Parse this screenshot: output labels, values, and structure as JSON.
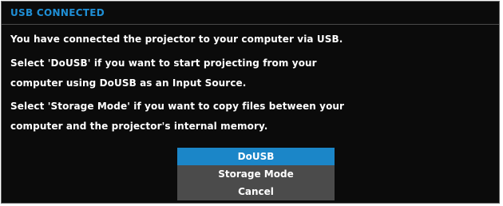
{
  "theme": {
    "title_color": "#1f8fd6",
    "selected_bg": "#1b86c8",
    "menu_bg": "#4b4b4b"
  },
  "dialog": {
    "title": "USB CONNECTED",
    "lines": [
      "You have connected the projector to your computer via USB.",
      "Select 'DoUSB' if you want to start projecting from your",
      "computer using DoUSB as an Input Source.",
      "Select 'Storage Mode' if you want to copy files between your",
      "computer and the projector's internal memory."
    ]
  },
  "menu": {
    "selected_index": 0,
    "items": [
      {
        "label": "DoUSB"
      },
      {
        "label": "Storage Mode"
      },
      {
        "label": "Cancel"
      }
    ]
  }
}
